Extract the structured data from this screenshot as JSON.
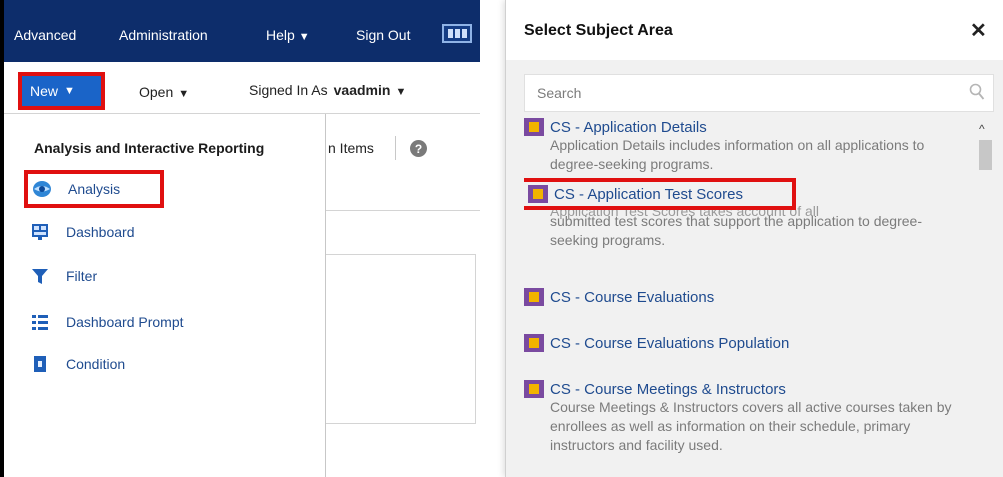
{
  "topbar": {
    "advanced": "Advanced",
    "administration": "Administration",
    "help": "Help",
    "sign_out": "Sign Out"
  },
  "toolbar": {
    "new": "New",
    "open": "Open",
    "signed_in_as": "Signed In As",
    "user": "vaadmin"
  },
  "background": {
    "items_fragment": "n Items"
  },
  "new_menu": {
    "title": "Analysis and Interactive Reporting",
    "items": [
      {
        "label": "Analysis",
        "icon": "analysis-icon"
      },
      {
        "label": "Dashboard",
        "icon": "dashboard-icon"
      },
      {
        "label": "Filter",
        "icon": "filter-icon"
      },
      {
        "label": "Dashboard Prompt",
        "icon": "dashboard-prompt-icon"
      },
      {
        "label": "Condition",
        "icon": "condition-icon"
      }
    ]
  },
  "dialog": {
    "title": "Select Subject Area",
    "close": "✕",
    "search_placeholder": "Search",
    "subject_areas": [
      {
        "title": "CS - Application Details",
        "desc": "Application Details includes information on all applications to degree-seeking programs."
      },
      {
        "title": "CS - Application Test Scores",
        "desc_overlap": "Application Test Scores takes account of all",
        "desc_visible": "account of all",
        "desc_rest": "submitted test scores that support the application to degree-seeking programs."
      },
      {
        "title": "CS - Course Evaluations",
        "desc": ""
      },
      {
        "title": "CS - Course Evaluations Population",
        "desc": ""
      },
      {
        "title": "CS - Course Meetings & Instructors",
        "desc": "Course Meetings & Instructors covers all active courses taken by enrollees as well as information on their schedule, primary instructors and facility used."
      }
    ]
  },
  "colors": {
    "topbar_bg": "#0d2d6b",
    "new_button_bg": "#1a64c8",
    "highlight_border": "#e01010",
    "link_text": "#1f4b8f",
    "desc_text": "#7b7b7b",
    "subject_icon_purple": "#7a4aa0",
    "subject_icon_yellow": "#f2b400"
  }
}
